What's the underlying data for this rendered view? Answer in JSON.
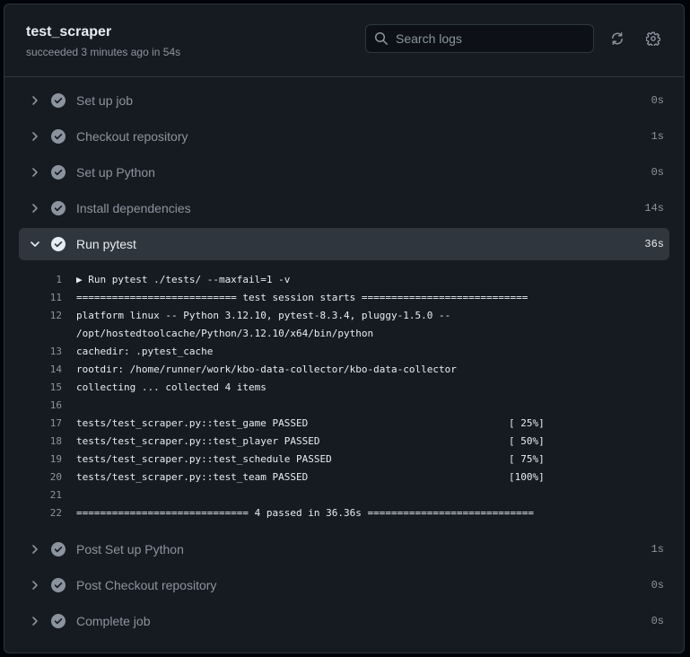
{
  "job": {
    "title": "test_scraper",
    "status": "succeeded 3 minutes ago in 54s"
  },
  "search": {
    "placeholder": "Search logs"
  },
  "colors": {
    "background": "#010409",
    "panel": "#161b22",
    "text": "#e6edf3",
    "muted": "#8b949e",
    "expanded_bg": "#30363d"
  },
  "icons": {
    "search": "search-icon",
    "refresh": "sync-icon",
    "settings": "gear-icon",
    "chevron": "chevron-right-icon",
    "check": "check-circle-fill-icon"
  },
  "steps_before": [
    {
      "name": "Set up job",
      "duration": "0s"
    },
    {
      "name": "Checkout repository",
      "duration": "1s"
    },
    {
      "name": "Set up Python",
      "duration": "0s"
    },
    {
      "name": "Install dependencies",
      "duration": "14s"
    }
  ],
  "expanded_step": {
    "name": "Run pytest",
    "duration": "36s",
    "log_lines": [
      {
        "num": "1",
        "text": "▶ Run pytest ./tests/ --maxfail=1 -v",
        "pct": ""
      },
      {
        "num": "11",
        "text": "=========================== test session starts ============================",
        "pct": ""
      },
      {
        "num": "12",
        "text": "platform linux -- Python 3.12.10, pytest-8.3.4, pluggy-1.5.0 --",
        "pct": ""
      },
      {
        "num": "",
        "text": "/opt/hostedtoolcache/Python/3.12.10/x64/bin/python",
        "pct": ""
      },
      {
        "num": "13",
        "text": "cachedir: .pytest_cache",
        "pct": ""
      },
      {
        "num": "14",
        "text": "rootdir: /home/runner/work/kbo-data-collector/kbo-data-collector",
        "pct": ""
      },
      {
        "num": "15",
        "text": "collecting ... collected 4 items",
        "pct": ""
      },
      {
        "num": "16",
        "text": "",
        "pct": ""
      },
      {
        "num": "17",
        "text": "tests/test_scraper.py::test_game PASSED",
        "pct": "[ 25%]"
      },
      {
        "num": "18",
        "text": "tests/test_scraper.py::test_player PASSED",
        "pct": "[ 50%]"
      },
      {
        "num": "19",
        "text": "tests/test_scraper.py::test_schedule PASSED",
        "pct": "[ 75%]"
      },
      {
        "num": "20",
        "text": "tests/test_scraper.py::test_team PASSED",
        "pct": "[100%]"
      },
      {
        "num": "21",
        "text": "",
        "pct": ""
      },
      {
        "num": "22",
        "text": "============================= 4 passed in 36.36s ============================",
        "pct": ""
      }
    ]
  },
  "steps_after": [
    {
      "name": "Post Set up Python",
      "duration": "1s"
    },
    {
      "name": "Post Checkout repository",
      "duration": "0s"
    },
    {
      "name": "Complete job",
      "duration": "0s"
    }
  ]
}
